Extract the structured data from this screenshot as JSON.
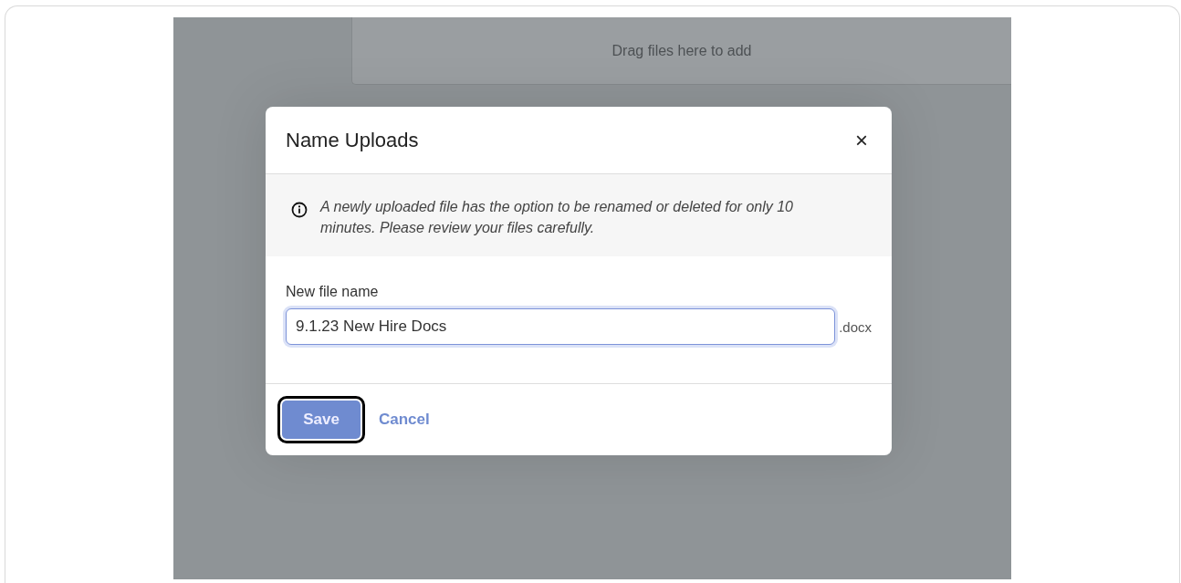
{
  "background": {
    "dropzone": {
      "text": "Drag files here to add"
    }
  },
  "dialog": {
    "title": "Name Uploads",
    "close": "×",
    "notice": "A newly uploaded file has the option to be renamed or deleted for only 10 minutes. Please review your files carefully.",
    "field": {
      "label": "New file name",
      "value": "9.1.23 New Hire Docs",
      "suffix": ".docx",
      "focused": true
    },
    "buttons": [
      {
        "kind": "primary",
        "label": "Save",
        "focused": true
      },
      {
        "kind": "link",
        "label": "Cancel",
        "focused": false
      }
    ]
  }
}
